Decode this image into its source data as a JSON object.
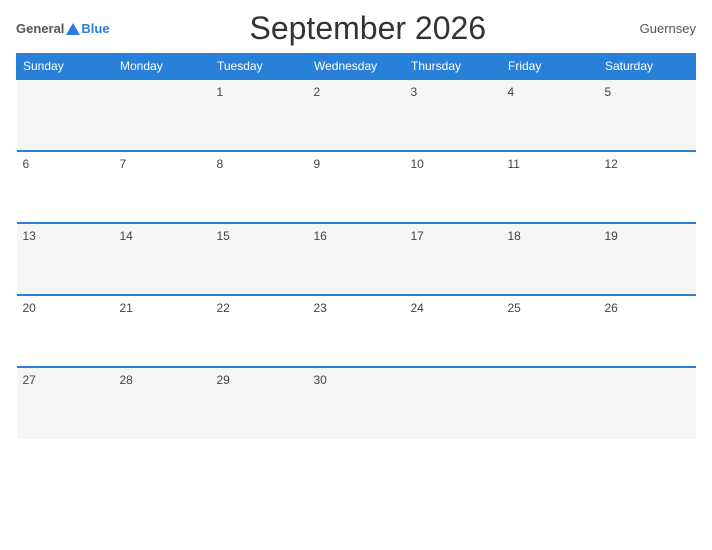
{
  "header": {
    "logo_general": "General",
    "logo_blue": "Blue",
    "title": "September 2026",
    "country": "Guernsey"
  },
  "days_of_week": [
    "Sunday",
    "Monday",
    "Tuesday",
    "Wednesday",
    "Thursday",
    "Friday",
    "Saturday"
  ],
  "weeks": [
    [
      "",
      "",
      "1",
      "2",
      "3",
      "4",
      "5"
    ],
    [
      "6",
      "7",
      "8",
      "9",
      "10",
      "11",
      "12"
    ],
    [
      "13",
      "14",
      "15",
      "16",
      "17",
      "18",
      "19"
    ],
    [
      "20",
      "21",
      "22",
      "23",
      "24",
      "25",
      "26"
    ],
    [
      "27",
      "28",
      "29",
      "30",
      "",
      "",
      ""
    ]
  ]
}
